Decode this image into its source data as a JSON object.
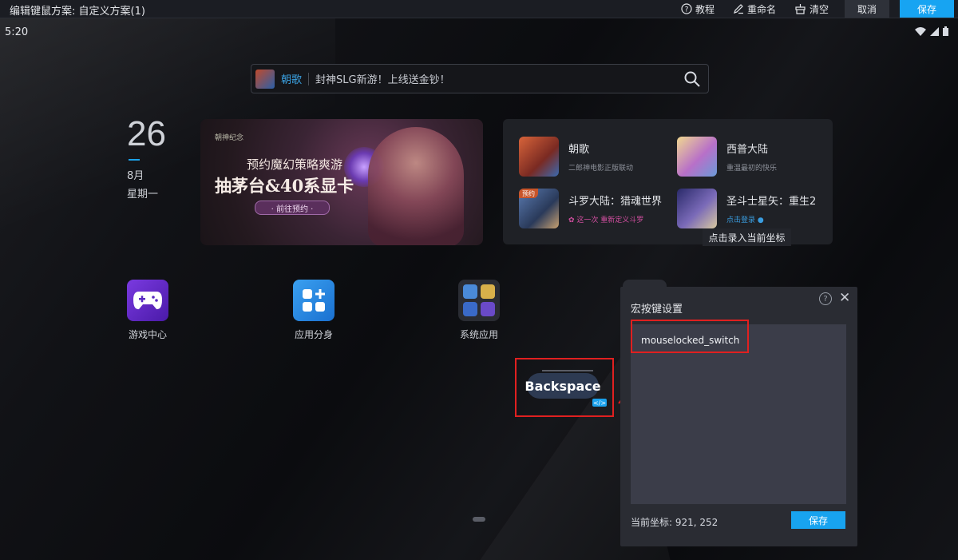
{
  "window": {
    "title": "编辑键鼠方案: 自定义方案(1)",
    "toolbar": {
      "tutorial_label": "教程",
      "rename_label": "重命名",
      "clear_label": "清空",
      "cancel_label": "取消",
      "save_label": "保存"
    }
  },
  "status": {
    "time": "5:20"
  },
  "search": {
    "game": "朝歌",
    "promo": "封神SLG新游！上线送金钞！",
    "icon": "search-icon"
  },
  "clock": {
    "day": "26",
    "month": "8月",
    "weekday": "星期一"
  },
  "banner": {
    "brand": "朝神纪念",
    "line1": "预约魔幻策略爽游",
    "line2": "抽茅台&40系显卡",
    "cta": "· 前往预约 ·"
  },
  "games": [
    {
      "name": "朝歌",
      "subtitle": "二郎神电影正版联动",
      "color": "#b8502a"
    },
    {
      "name": "西普大陆",
      "subtitle": "重温最初的快乐",
      "color": "#d8a86a"
    },
    {
      "name": "斗罗大陆：猎魂世界",
      "subtitle": "✿ 这一次 重新定义斗罗",
      "badge": "预约",
      "color": "#3e5a88"
    },
    {
      "name": "圣斗士星矢：重生2",
      "subtitle": "点击登录 ●",
      "color": "#3a3a78"
    }
  ],
  "tooltip": "点击录入当前坐标",
  "apps": [
    {
      "label": "游戏中心",
      "icon": "gamepad-icon"
    },
    {
      "label": "应用分身",
      "icon": "app-clone-icon"
    },
    {
      "label": "系统应用",
      "icon": "system-apps-icon"
    }
  ],
  "macro_key": {
    "label": "Backspace",
    "tag": "</>"
  },
  "macro_panel": {
    "title": "宏按键设置",
    "code": "mouselocked_switch",
    "coord_label": "当前坐标:",
    "coord_value": "921, 252",
    "save_label": "保存"
  },
  "colors": {
    "accent": "#17a4f2",
    "highlight": "#e02020",
    "panel": "#2a2c33"
  }
}
